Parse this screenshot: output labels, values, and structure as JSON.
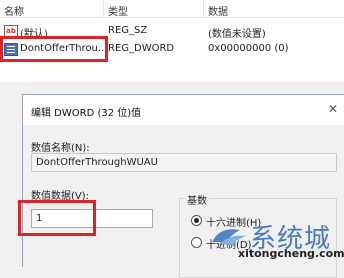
{
  "registry": {
    "headers": {
      "name": "名称",
      "type": "类型",
      "data": "数据"
    },
    "rows": [
      {
        "name": "(默认)",
        "type": "REG_SZ",
        "data": "(数值未设置)",
        "icon": "string-value-icon"
      },
      {
        "name": "DontOfferThrou...",
        "type": "REG_DWORD",
        "data": "0x00000000 (0)",
        "icon": "dword-value-icon"
      }
    ]
  },
  "dialog": {
    "title": "编辑 DWORD (32 位)值",
    "close_glyph": "✕",
    "value_name_label": "数值名称(N):",
    "value_name": "DontOfferThroughWUAU",
    "value_data_label": "数值数据(V):",
    "value_data": "1",
    "base_label": "基数",
    "base_options": [
      {
        "label": "十六进制(H)",
        "checked": true
      },
      {
        "label": "十进制(D)",
        "checked": false
      }
    ]
  },
  "watermark": {
    "text": "系统城",
    "url": "xitongcheng.com"
  },
  "colors": {
    "highlight": "#d9252a",
    "watermark": "#3a6fb5"
  }
}
